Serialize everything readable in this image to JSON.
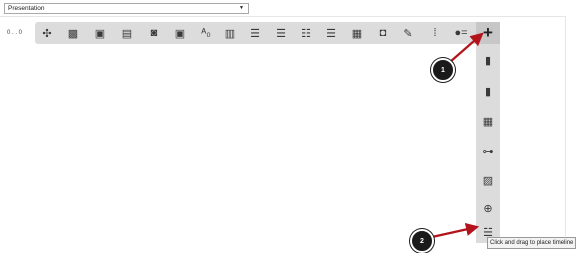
{
  "mode_select": {
    "selected": "Presentation"
  },
  "zoom": {
    "label": "0 . . 0"
  },
  "toolbar": {
    "tools": [
      {
        "icon": "puzzle-icon",
        "glyph": "✣"
      },
      {
        "icon": "image-collage-icon",
        "glyph": "▩"
      },
      {
        "icon": "slide-image-icon",
        "glyph": "▣"
      },
      {
        "icon": "slide-text-icon",
        "glyph": "▤"
      },
      {
        "icon": "slide-video-icon",
        "glyph": "◙"
      },
      {
        "icon": "slide-audio-icon",
        "glyph": "▣"
      },
      {
        "icon": "letter-spacing-icon",
        "glyph": "ᴬ₀"
      },
      {
        "icon": "columns-list-icon",
        "glyph": "▥"
      },
      {
        "icon": "numbered-list-icon",
        "glyph": "☰"
      },
      {
        "icon": "bulleted-list-icon",
        "glyph": "☰"
      },
      {
        "icon": "checklist-icon",
        "glyph": "☷"
      },
      {
        "icon": "ordered-list-icon",
        "glyph": "☰"
      },
      {
        "icon": "layout-icon",
        "glyph": "▦"
      },
      {
        "icon": "picture-icon",
        "glyph": "◘"
      },
      {
        "icon": "edit-external-icon",
        "glyph": "✎"
      },
      {
        "icon": "dotted-list-icon",
        "glyph": "⁞"
      },
      {
        "icon": "toggle-list-icon",
        "glyph": "●="
      }
    ],
    "add_glyph": "+"
  },
  "vertical_tools": [
    {
      "icon": "card-icon",
      "glyph": "▮"
    },
    {
      "icon": "card-edit-icon",
      "glyph": "▮"
    },
    {
      "icon": "grid-icon",
      "glyph": "▦"
    },
    {
      "icon": "hierarchy-icon",
      "glyph": "⊶"
    },
    {
      "icon": "image-icon",
      "glyph": "▨"
    },
    {
      "icon": "link-icon",
      "glyph": "⊕"
    },
    {
      "icon": "timeline-icon",
      "glyph": "☱"
    }
  ],
  "callouts": [
    {
      "label": "1"
    },
    {
      "label": "2"
    }
  ],
  "tooltip": {
    "text": "Click and drag to place timeline"
  },
  "colors": {
    "arrow": "#b3141b",
    "toolbar_bg": "#dcdcdc",
    "callout_bg": "#1a1a1a"
  }
}
